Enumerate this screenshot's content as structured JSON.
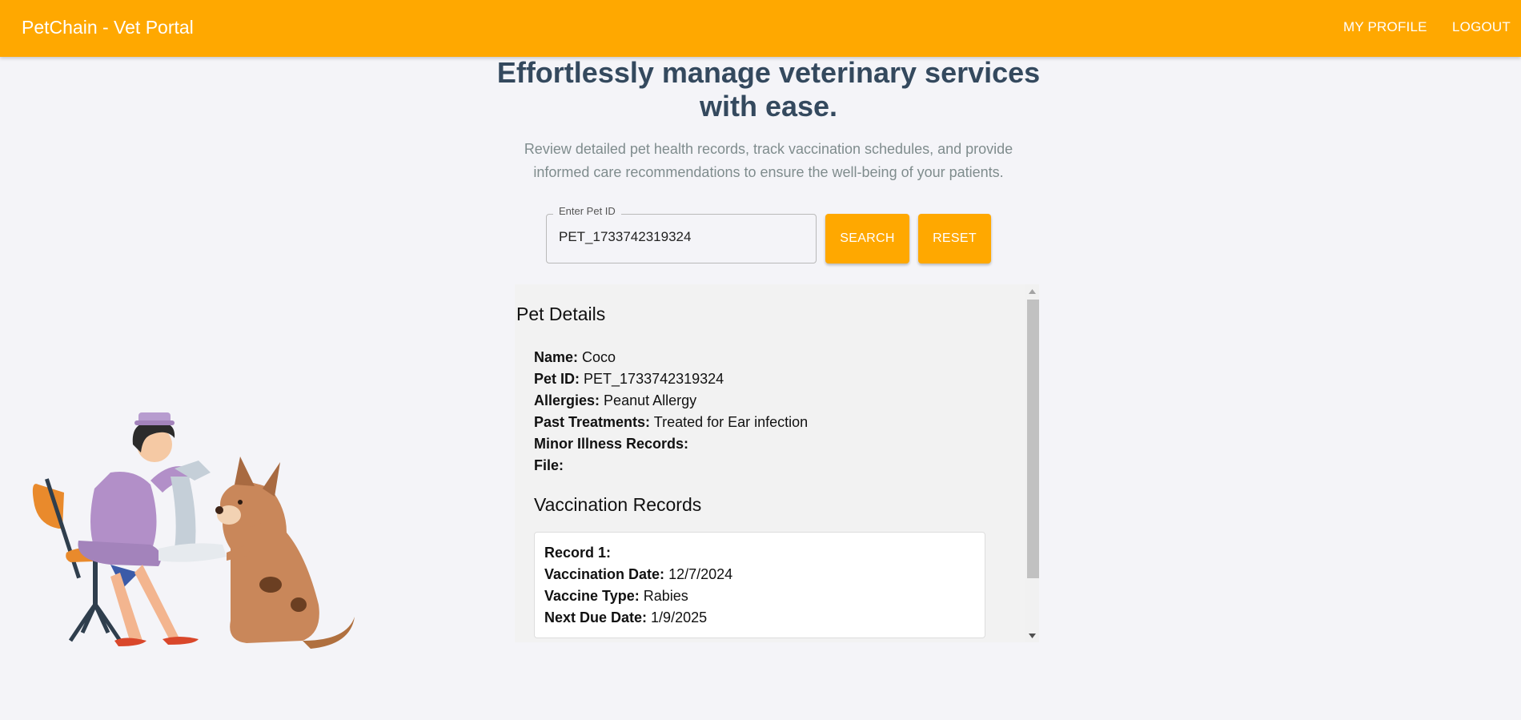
{
  "app": {
    "title": "PetChain - Vet Portal",
    "nav": {
      "profile": "MY PROFILE",
      "logout": "LOGOUT"
    },
    "accent_color": "#ffa800"
  },
  "hero": {
    "heading": "Effortlessly manage veterinary services with ease.",
    "subtitle": "Review detailed pet health records, track vaccination schedules, and provide informed care recommendations to ensure the well-being of your patients."
  },
  "search": {
    "label": "Enter Pet ID",
    "value": "PET_1733742319324",
    "search_button": "SEARCH",
    "reset_button": "RESET"
  },
  "pet_details": {
    "section_title": "Pet Details",
    "fields": [
      {
        "label": "Name:",
        "value": "Coco"
      },
      {
        "label": "Pet ID:",
        "value": "PET_1733742319324"
      },
      {
        "label": "Allergies:",
        "value": "Peanut Allergy"
      },
      {
        "label": "Past Treatments:",
        "value": "Treated for Ear infection"
      },
      {
        "label": "Minor Illness Records:",
        "value": ""
      },
      {
        "label": "File:",
        "value": ""
      }
    ]
  },
  "vaccination": {
    "section_title": "Vaccination Records",
    "records": [
      {
        "title": "Record 1:",
        "fields": [
          {
            "label": "Vaccination Date:",
            "value": "12/7/2024"
          },
          {
            "label": "Vaccine Type:",
            "value": "Rabies"
          },
          {
            "label": "Next Due Date:",
            "value": "1/9/2025"
          }
        ]
      }
    ]
  },
  "illustration": {
    "icon": "vet-bandaging-dog-illustration"
  }
}
